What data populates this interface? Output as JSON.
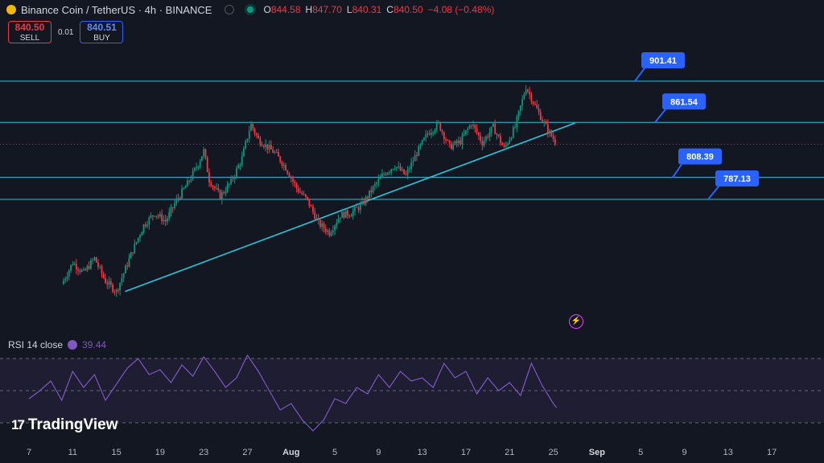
{
  "header": {
    "title": "Binance Coin / TetherUS · 4h · BINANCE",
    "ohlc": [
      {
        "label": "O",
        "value": "844.58"
      },
      {
        "label": "H",
        "value": "847.70"
      },
      {
        "label": "L",
        "value": "840.31"
      },
      {
        "label": "C",
        "value": "840.50"
      },
      {
        "label": "",
        "value": "−4.08 (−0.48%)"
      }
    ]
  },
  "trade": {
    "sell_price": "840.50",
    "sell_label": "SELL",
    "spread": "0.01",
    "buy_price": "840.51",
    "buy_label": "BUY"
  },
  "rsi": {
    "label": "RSI 14 close",
    "value": "39.44"
  },
  "logo": {
    "text": "TradingView"
  },
  "colors": {
    "bg": "#131722",
    "up": "#089981",
    "down": "#f23645",
    "level": "#26c6da",
    "rsi": "#7e57c2",
    "callout": "#2962ff"
  },
  "chart_data": {
    "type": "candlestick",
    "y_unit": "USDT",
    "ylim": [
      700,
      920
    ],
    "x_ticks": [
      "7",
      "11",
      "15",
      "19",
      "23",
      "27",
      "Aug",
      "5",
      "9",
      "13",
      "17",
      "21",
      "25",
      "Sep",
      "5",
      "9",
      "13",
      "17"
    ],
    "price_path": [
      [
        10.0,
        705
      ],
      [
        11.0,
        726
      ],
      [
        12.0,
        716
      ],
      [
        13.0,
        730
      ],
      [
        14.0,
        708
      ],
      [
        15.0,
        698
      ],
      [
        16.5,
        738
      ],
      [
        17.5,
        762
      ],
      [
        18.5,
        774
      ],
      [
        19.5,
        766
      ],
      [
        20.5,
        786
      ],
      [
        21.5,
        802
      ],
      [
        22.5,
        822
      ],
      [
        23.0,
        834
      ],
      [
        23.5,
        806
      ],
      [
        24.5,
        790
      ],
      [
        25.5,
        804
      ],
      [
        26.5,
        827
      ],
      [
        27.3,
        860
      ],
      [
        28.0,
        845
      ],
      [
        29.5,
        832
      ],
      [
        30.5,
        818
      ],
      [
        31.5,
        798
      ],
      [
        32.5,
        786
      ],
      [
        33.5,
        764
      ],
      [
        34.5,
        755
      ],
      [
        35.5,
        772
      ],
      [
        36.5,
        774
      ],
      [
        37.5,
        782
      ],
      [
        38.5,
        798
      ],
      [
        39.5,
        812
      ],
      [
        40.5,
        820
      ],
      [
        41.5,
        810
      ],
      [
        42.5,
        832
      ],
      [
        43.5,
        851
      ],
      [
        44.5,
        860
      ],
      [
        45.5,
        838
      ],
      [
        46.5,
        843
      ],
      [
        47.5,
        861
      ],
      [
        48.5,
        842
      ],
      [
        49.5,
        857
      ],
      [
        50.5,
        836
      ],
      [
        51.5,
        857
      ],
      [
        52.5,
        896
      ],
      [
        53.5,
        874
      ],
      [
        54.5,
        854
      ],
      [
        55.0,
        846
      ],
      [
        55.3,
        840.5
      ]
    ],
    "levels": [
      901.41,
      861.54,
      808.39,
      787.13
    ],
    "current_price": 840.5,
    "trendline": [
      [
        15.8,
        698
      ],
      [
        57.0,
        861
      ]
    ],
    "rsi": {
      "ylim": [
        20,
        80
      ],
      "bands": [
        70,
        50,
        30
      ],
      "path": [
        [
          7,
          45
        ],
        [
          8,
          50
        ],
        [
          9,
          56
        ],
        [
          10,
          44
        ],
        [
          11,
          62
        ],
        [
          12,
          52
        ],
        [
          13,
          60
        ],
        [
          14,
          44
        ],
        [
          15,
          54
        ],
        [
          16,
          64
        ],
        [
          17,
          70
        ],
        [
          18,
          60
        ],
        [
          19,
          63
        ],
        [
          20,
          55
        ],
        [
          21,
          66
        ],
        [
          22,
          59
        ],
        [
          23,
          71
        ],
        [
          24,
          62
        ],
        [
          25,
          52
        ],
        [
          26,
          58
        ],
        [
          27,
          72
        ],
        [
          28,
          62
        ],
        [
          29,
          50
        ],
        [
          30,
          38
        ],
        [
          31,
          42
        ],
        [
          32,
          32
        ],
        [
          33,
          25
        ],
        [
          34,
          32
        ],
        [
          35,
          45
        ],
        [
          36,
          42
        ],
        [
          37,
          52
        ],
        [
          38,
          48
        ],
        [
          39,
          60
        ],
        [
          40,
          52
        ],
        [
          41,
          62
        ],
        [
          42,
          56
        ],
        [
          43,
          58
        ],
        [
          44,
          52
        ],
        [
          45,
          67
        ],
        [
          46,
          58
        ],
        [
          47,
          62
        ],
        [
          48,
          48
        ],
        [
          49,
          58
        ],
        [
          50,
          50
        ],
        [
          51,
          55
        ],
        [
          52,
          47
        ],
        [
          53,
          67
        ],
        [
          54,
          53
        ],
        [
          55,
          42
        ],
        [
          55.3,
          39.44
        ]
      ]
    }
  }
}
